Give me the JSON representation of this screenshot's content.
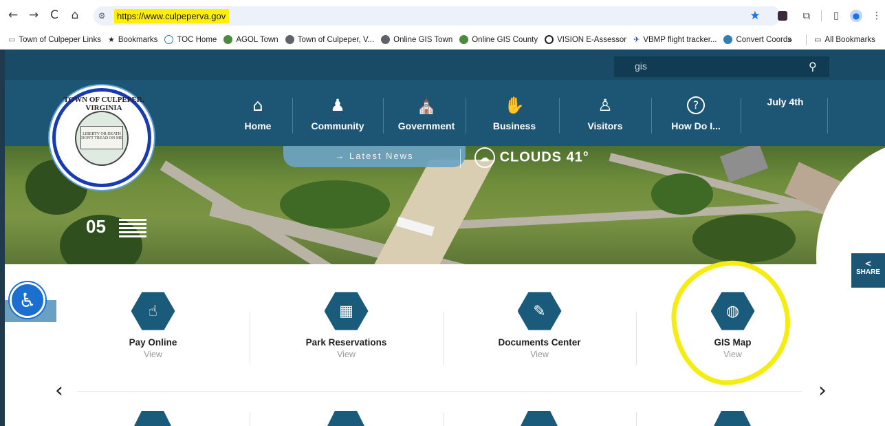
{
  "browser": {
    "url": "https://www.culpeperva.gov",
    "back_icon": "←",
    "forward_icon": "→",
    "reload_icon": "C",
    "home_icon": "⌂",
    "bookmarks": [
      {
        "label": "Town of Culpeper Links",
        "color": "#5f6368"
      },
      {
        "label": "Bookmarks",
        "color": "#5f6368"
      },
      {
        "label": "TOC Home",
        "color": "#1a73e8"
      },
      {
        "label": "AGOL Town",
        "color": "#4c8a3e"
      },
      {
        "label": "Town of Culpeper, V...",
        "color": "#5f6368"
      },
      {
        "label": "Online GIS Town",
        "color": "#5f6368"
      },
      {
        "label": "Online GIS County",
        "color": "#4c8a3e"
      },
      {
        "label": "VISION E-Assessor",
        "color": "#202124"
      },
      {
        "label": "VBMP flight tracker...",
        "color": "#2b3fb5"
      },
      {
        "label": "Convert Coords",
        "color": "#4c8a3e"
      }
    ],
    "more": "»",
    "all_bookmarks": "All Bookmarks"
  },
  "site": {
    "search_value": "gis",
    "nav": [
      {
        "label": "Home",
        "icon": "home-icon",
        "glyph": "⌂"
      },
      {
        "label": "Community",
        "icon": "community-icon",
        "glyph": "♟"
      },
      {
        "label": "Government",
        "icon": "capitol-icon",
        "glyph": "⛪"
      },
      {
        "label": "Business",
        "icon": "handshake-icon",
        "glyph": "✋"
      },
      {
        "label": "Visitors",
        "icon": "traveler-icon",
        "glyph": "♙"
      },
      {
        "label": "How Do I...",
        "icon": "question-icon",
        "glyph": "?"
      },
      {
        "label": "July 4th",
        "icon": "",
        "glyph": ""
      }
    ],
    "logo": {
      "ring_text": "TOWN OF CULPEPER, VIRGINIA",
      "flag_text": "LIBERTY OR DEATH DON'T TREAD ON ME"
    },
    "hero": {
      "latest_news": "→ Latest News",
      "weather": "CLOUDS 41°",
      "date": "05"
    },
    "quick_links": [
      {
        "title": "Pay Online",
        "sub": "View",
        "icon": "pay-online-icon",
        "glyph": "☝"
      },
      {
        "title": "Park Reservations",
        "sub": "View",
        "icon": "calendar-icon",
        "glyph": "▦"
      },
      {
        "title": "Documents Center",
        "sub": "View",
        "icon": "documents-icon",
        "glyph": "✎"
      },
      {
        "title": "GIS Map",
        "sub": "View",
        "icon": "globe-icon",
        "glyph": "◍"
      }
    ],
    "share": "SHARE",
    "colors": {
      "brand_dark": "#194a66",
      "brand": "#1d5575",
      "highlight": "#f5ec12"
    }
  }
}
